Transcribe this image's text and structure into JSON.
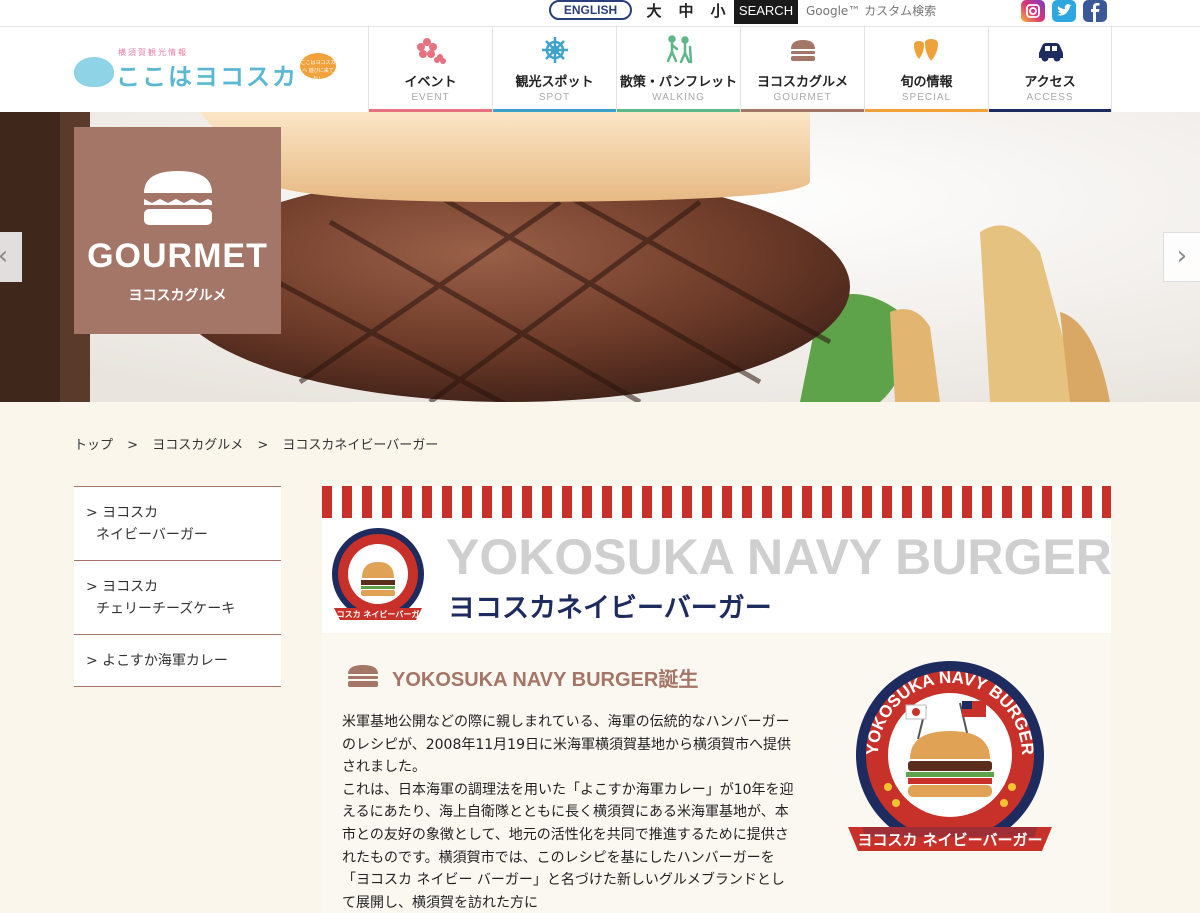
{
  "topbar": {
    "english_label": "ENGLISH",
    "font_large": "大",
    "font_medium": "中",
    "font_small": "小",
    "search_label": "SEARCH",
    "search_placeholder": "Google™ カスタム検索",
    "social": [
      "instagram-icon",
      "twitter-icon",
      "facebook-icon"
    ]
  },
  "logo": {
    "sub": "横須賀観光情報",
    "main": "ここはヨコスカ",
    "bubble": "ここはヨコスカへ 遊びに来てね！"
  },
  "nav": {
    "items": [
      {
        "jp": "イベント",
        "en": "EVENT",
        "icon": "sakura-icon",
        "color": "#e8717f"
      },
      {
        "jp": "観光スポット",
        "en": "SPOT",
        "icon": "ship-wheel-icon",
        "color": "#3fa3c7"
      },
      {
        "jp": "散策・パンフレット",
        "en": "WALKING",
        "icon": "hikers-icon",
        "color": "#5fb789"
      },
      {
        "jp": "ヨコスカグルメ",
        "en": "GOURMET",
        "icon": "burger-icon",
        "color": "#a47667"
      },
      {
        "jp": "旬の情報",
        "en": "SPECIAL",
        "icon": "strawberry-icon",
        "color": "#f0a23a"
      },
      {
        "jp": "アクセス",
        "en": "ACCESS",
        "icon": "car-icon",
        "color": "#1e2b5e"
      }
    ]
  },
  "hero": {
    "title": "GOURMET",
    "subtitle": "ヨコスカグルメ"
  },
  "breadcrumb": {
    "items": [
      "トップ",
      "ヨコスカグルメ",
      "ヨコスカネイビーバーガー"
    ],
    "separator": ">"
  },
  "side_menu": {
    "items": [
      {
        "line1": "> ヨコスカ",
        "line2": "ネイビーバーガー"
      },
      {
        "line1": "> ヨコスカ",
        "line2": "チェリーチーズケーキ"
      },
      {
        "line1": "> よこすか海軍カレー",
        "line2": ""
      }
    ]
  },
  "main": {
    "title_en": "YOKOSUKA NAVY BURGER",
    "title_jp": "ヨコスカネイビーバーガー",
    "badge_text_top": "YOKOSUKA NAVY BURGER",
    "badge_text_bottom": "ヨコスカ ネイビーバーガー",
    "section_title": "YOKOSUKA NAVY BURGER誕生",
    "body": "米軍基地公開などの際に親しまれている、海軍の伝統的なハンバーガーのレシピが、2008年11月19日に米海軍横須賀基地から横須賀市へ提供されました。\nこれは、日本海軍の調理法を用いた「よこすか海軍カレー」が10年を迎えるにあたり、海上自衛隊とともに長く横須賀にある米海軍基地が、本市との友好の象徴として、地元の活性化を共同で推進するために提供されたものです。横須賀市では、このレシピを基にしたハンバーガーを「ヨコスカ ネイビー バーガー」と名づけた新しいグルメブランドとして展開し、横須賀を訪れた方に"
  },
  "colors": {
    "gourmet": "#a47667",
    "navy": "#1e2b5e",
    "stripe_red": "#c8312a"
  }
}
